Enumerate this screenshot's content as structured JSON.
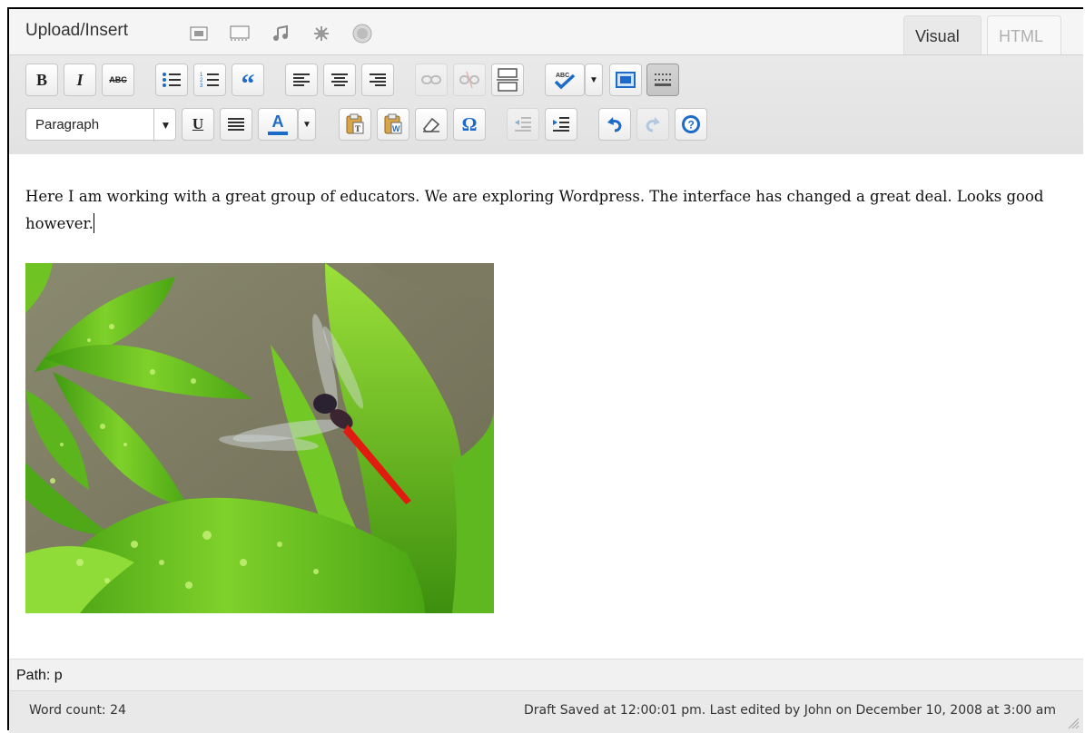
{
  "media_bar": {
    "label": "Upload/Insert",
    "icons": [
      "add-image-icon",
      "add-video-icon",
      "add-audio-icon",
      "add-media-icon",
      "add-poll-icon"
    ]
  },
  "tabs": {
    "visual": "Visual",
    "html": "HTML",
    "active": "Visual"
  },
  "toolbar": {
    "bold": "B",
    "italic": "I",
    "strike": "ABC",
    "blockquote": "“",
    "underline": "U",
    "text_color": "A",
    "omega": "Ω",
    "format_select": "Paragraph"
  },
  "content": {
    "paragraph": "Here I am working with a great group of educators. We are exploring Wordpress. The interface has changed a great deal. Looks good however."
  },
  "path_bar": {
    "text": "Path: p"
  },
  "status": {
    "word_count": "Word count: 24",
    "draft": "Draft Saved at 12:00:01 pm. Last edited by John on December 10, 2008 at 3:00 am"
  },
  "colors": {
    "accent_blue": "#1d6bc9",
    "toolbar_bg": "#e6e6e6",
    "active_tab": "#e9e9e9"
  }
}
